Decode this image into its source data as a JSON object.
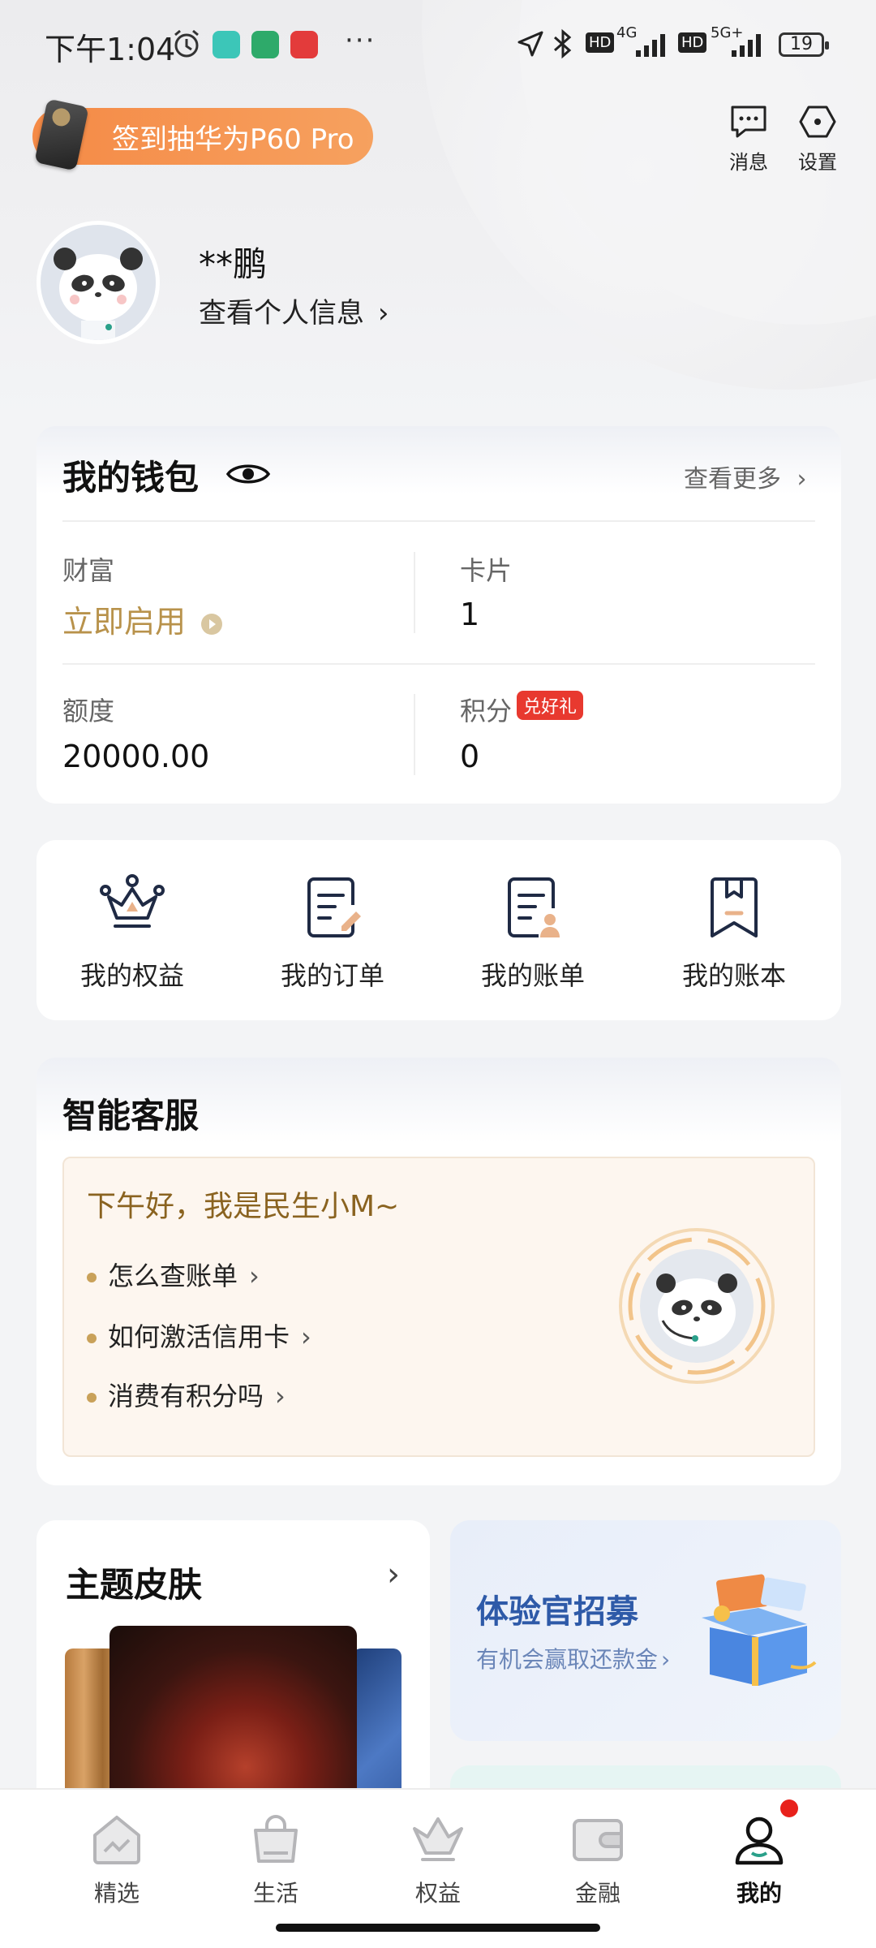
{
  "status_bar": {
    "time": "下午1:04",
    "more": "···",
    "net1": "4G",
    "net2": "5G+",
    "hd": "HD",
    "battery": "19"
  },
  "header": {
    "promo": "签到抽华为P60 Pro",
    "messages_label": "消息",
    "settings_label": "设置"
  },
  "profile": {
    "name": "**鹏",
    "view_info": "查看个人信息"
  },
  "wallet": {
    "title": "我的钱包",
    "more": "查看更多",
    "wealth_label": "财富",
    "wealth_value": "立即启用",
    "cards_label": "卡片",
    "cards_value": "1",
    "limit_label": "额度",
    "limit_value": "20000.00",
    "points_label": "积分",
    "points_badge": "兑好礼",
    "points_value": "0"
  },
  "quick_links": [
    {
      "label": "我的权益"
    },
    {
      "label": "我的订单"
    },
    {
      "label": "我的账单"
    },
    {
      "label": "我的账本"
    }
  ],
  "service": {
    "title": "智能客服",
    "greeting": "下午好，我是民生小M~",
    "faqs": [
      "怎么查账单",
      "如何激活信用卡",
      "消费有积分吗"
    ]
  },
  "skin": {
    "title": "主题皮肤"
  },
  "recruit": {
    "title": "体验官招募",
    "subtitle": "有机会赢取还款金"
  },
  "tabs": [
    {
      "label": "精选"
    },
    {
      "label": "生活"
    },
    {
      "label": "权益"
    },
    {
      "label": "金融"
    },
    {
      "label": "我的"
    }
  ],
  "colors": {
    "accent_gold": "#b8924b",
    "promo_orange": "#f58a46",
    "badge_red": "#e8392f",
    "recruit_blue": "#2e5aa8"
  }
}
